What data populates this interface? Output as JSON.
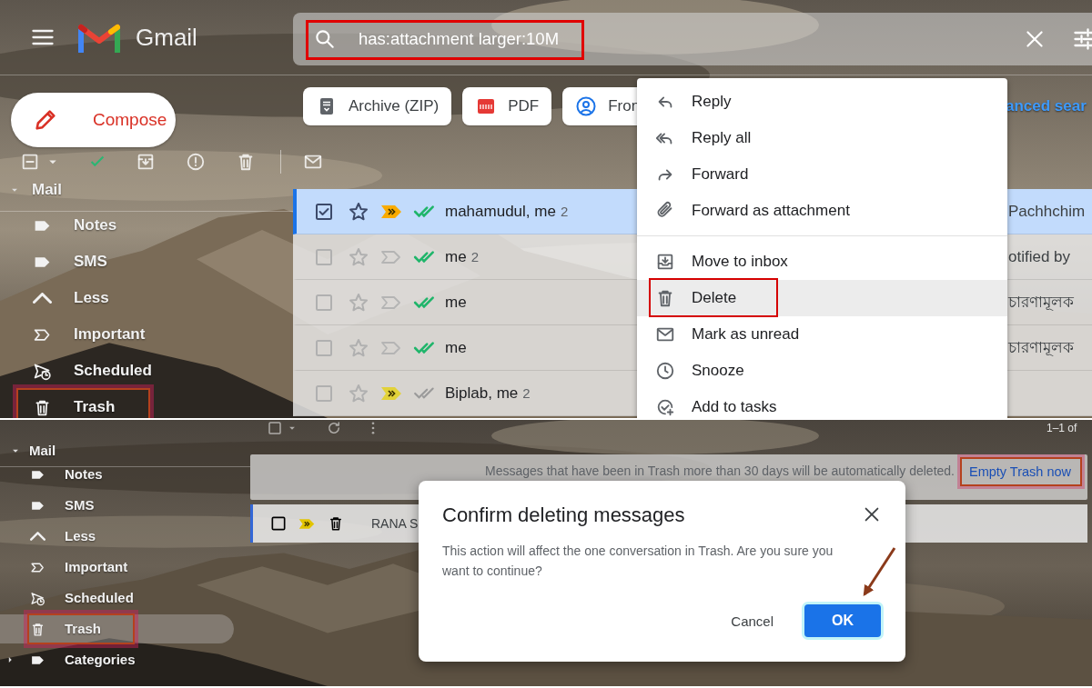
{
  "inbox_view": {
    "logo_text": "Gmail",
    "search": {
      "value": "has:attachment larger:10M",
      "annotated": true
    },
    "sidebar": {
      "compose": "Compose",
      "heading": "Mail",
      "expanded": true,
      "items": [
        {
          "label": "Notes",
          "kind": "label",
          "selected": false,
          "annotated": false
        },
        {
          "label": "SMS",
          "kind": "label",
          "selected": false,
          "annotated": false
        },
        {
          "label": "Less",
          "kind": "less",
          "selected": false,
          "annotated": false
        },
        {
          "label": "Important",
          "kind": "important",
          "selected": false,
          "annotated": false
        },
        {
          "label": "Scheduled",
          "kind": "scheduled",
          "selected": false,
          "annotated": false
        },
        {
          "label": "Trash",
          "kind": "trash",
          "selected": false,
          "annotated": true
        }
      ]
    },
    "chips": [
      {
        "label": "Archive (ZIP)",
        "kind": "archive"
      },
      {
        "label": "PDF",
        "kind": "pdf"
      },
      {
        "label": "Fron",
        "kind": "person"
      }
    ],
    "advanced_search_link": "anced sear",
    "rows": [
      {
        "selected": true,
        "checked": true,
        "starred": false,
        "important": true,
        "color": "#f9ab00",
        "read_receipt": true,
        "sender": "mahamudul, me",
        "count": "2",
        "snippet": "Pachhchim"
      },
      {
        "selected": false,
        "checked": false,
        "starred": false,
        "important": false,
        "read_receipt": true,
        "sender": "me",
        "count": "2",
        "snippet": "otified by"
      },
      {
        "selected": false,
        "checked": false,
        "starred": false,
        "important": false,
        "read_receipt": true,
        "sender": "me",
        "snippet": "চারণামূলক"
      },
      {
        "selected": false,
        "checked": false,
        "starred": false,
        "important": false,
        "read_receipt": true,
        "sender": "me",
        "snippet": "চারণামূলক"
      },
      {
        "selected": false,
        "checked": false,
        "starred": false,
        "important": true,
        "color": "#e2d23a",
        "read_receipt": false,
        "sender": "Biplab, me",
        "count": "2"
      }
    ],
    "context_menu": {
      "groups": [
        [
          {
            "label": "Reply",
            "kind": "reply",
            "selected": false,
            "annotated": false
          },
          {
            "label": "Reply all",
            "kind": "reply_all",
            "selected": false,
            "annotated": false
          },
          {
            "label": "Forward",
            "kind": "forward",
            "selected": false,
            "annotated": false
          },
          {
            "label": "Forward as attachment",
            "kind": "attachment",
            "selected": false,
            "annotated": false
          }
        ],
        [
          {
            "label": "Move to inbox",
            "kind": "move_inbox",
            "selected": false,
            "annotated": false
          },
          {
            "label": "Delete",
            "kind": "delete",
            "selected": true,
            "annotated": true
          },
          {
            "label": "Mark as unread",
            "kind": "unread",
            "selected": false,
            "annotated": false
          },
          {
            "label": "Snooze",
            "kind": "snooze",
            "selected": false,
            "annotated": false
          },
          {
            "label": "Add to tasks",
            "kind": "add_task",
            "selected": false,
            "annotated": false
          }
        ]
      ]
    }
  },
  "trash_view": {
    "count_text": "1–1 of",
    "sidebar": {
      "heading": "Mail",
      "expanded": true,
      "items": [
        {
          "label": "Notes",
          "kind": "label",
          "selected": false,
          "annotated": false
        },
        {
          "label": "SMS",
          "kind": "label",
          "selected": false,
          "annotated": false
        },
        {
          "label": "Less",
          "kind": "less",
          "selected": false,
          "annotated": false
        },
        {
          "label": "Important",
          "kind": "important",
          "selected": false,
          "annotated": false
        },
        {
          "label": "Scheduled",
          "kind": "scheduled",
          "selected": false,
          "annotated": false
        },
        {
          "label": "Trash",
          "kind": "trash",
          "selected": true,
          "annotated": true
        },
        {
          "label": "Categories",
          "kind": "categories",
          "selected": false,
          "annotated": false,
          "expanded": false
        }
      ]
    },
    "banner": {
      "text": "Messages that have been in Trash more than 30 days will be automatically deleted.",
      "link": "Empty Trash now",
      "annotated": true
    },
    "rows": [
      {
        "checked": false,
        "important": true,
        "color": "#e2c400",
        "sender": "RANA S"
      }
    ],
    "dialog": {
      "title": "Confirm deleting messages",
      "body": "This action will affect the one conversation in Trash. Are you sure you want to continue?",
      "buttons": [
        {
          "label": "Cancel",
          "kind": "text",
          "pointed": false
        },
        {
          "label": "OK",
          "kind": "primary",
          "pointed": true
        }
      ]
    }
  }
}
